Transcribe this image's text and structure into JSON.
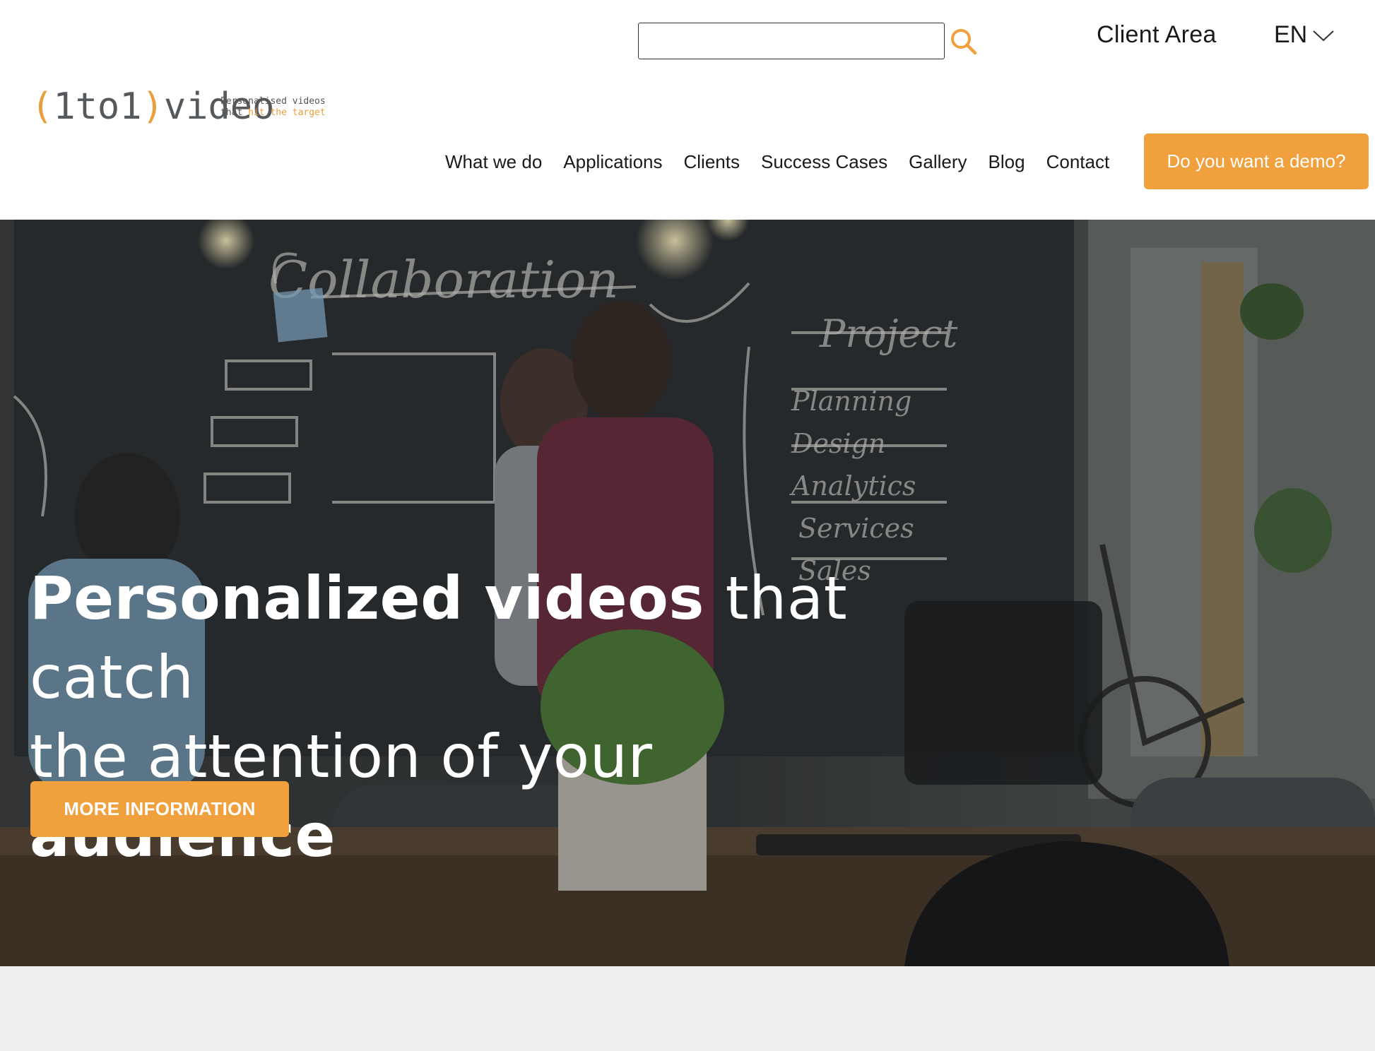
{
  "header": {
    "search": {
      "value": "",
      "placeholder": ""
    },
    "client_area": "Client Area",
    "language": "EN",
    "logo": {
      "mark": "(1to1)video",
      "tagline_line1": "Personalised videos",
      "tagline_that": "that",
      "tagline_highlight": "hit the target"
    },
    "nav": [
      {
        "label": "What we do"
      },
      {
        "label": "Applications"
      },
      {
        "label": "Clients"
      },
      {
        "label": "Success Cases"
      },
      {
        "label": "Gallery"
      },
      {
        "label": "Blog"
      },
      {
        "label": "Contact"
      }
    ],
    "demo_button": "Do you want a demo?"
  },
  "hero": {
    "title_bold_1": "Personalized videos",
    "title_light_1": "that catch",
    "title_light_2": "the attention of your",
    "title_bold_2": "audience",
    "button": "MORE INFORMATION",
    "background": "blurred office photo: people writing on a chalkboard with 'Collaboration', 'Project Dev.' drawings"
  },
  "colors": {
    "accent": "#f0a03c",
    "logo_gray": "#56595c",
    "text": "#1a1a1a",
    "band": "#efefef"
  },
  "icons": {
    "search": "search-icon",
    "lang": "chevron-down-icon"
  }
}
